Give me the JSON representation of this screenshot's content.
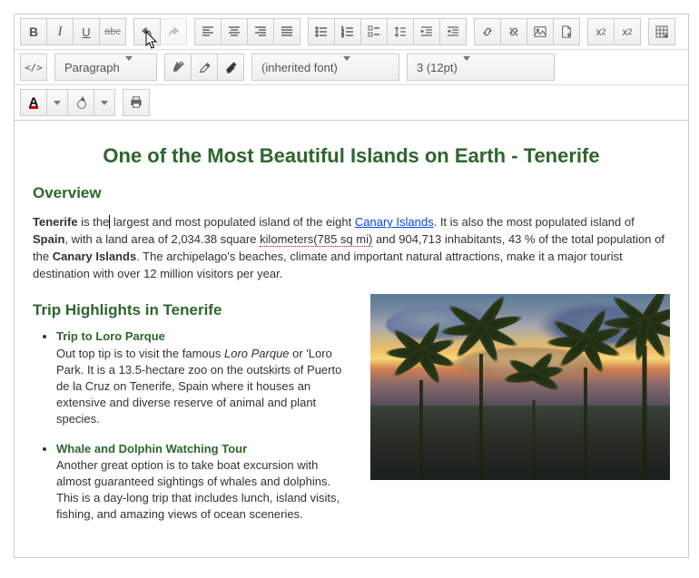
{
  "toolbar": {
    "bold": "B",
    "italic": "I",
    "underline": "U",
    "strike": "abc",
    "code": "</>",
    "paragraph_select": "Paragraph",
    "font_select": "(inherited font)",
    "size_select": "3 (12pt)",
    "color_a": "A",
    "sub": "x",
    "sub2": "2",
    "sup": "x",
    "sup2": "2"
  },
  "document": {
    "title": "One of the Most Beautiful Islands on Earth - Tenerife",
    "overview_heading": "Overview",
    "overview": {
      "w1": "Tenerife",
      "t1": " is the",
      "cursor": "|",
      "t1b": " largest and most populated island of the eight ",
      "link": "Canary Islands",
      "t2": ". It is also the most populated island of ",
      "w2": "Spain",
      "t3": ", with a land area of 2,034.38 square ",
      "sq1": "kilometers(785 sq mi)",
      "t4": " and 904,713 inhabitants, 43 % of the total population of the ",
      "w3": "Canary Islands",
      "t5": ". The archipelago's beaches, climate and important natural attractions, make it a major tourist destination with over 12 million visitors per year."
    },
    "highlights_heading": "Trip Highlights in Tenerife",
    "items": [
      {
        "title": "Trip to Loro Parque",
        "t1": "Out top tip is to visit the famous ",
        "em": "Loro Parque",
        "t2": " or 'Loro Park. It is a 13.5-hectare zoo on the outskirts of Puerto de la Cruz on Tenerife, Spain where it houses an extensive and diverse reserve of animal and plant species."
      },
      {
        "title": "Whale and Dolphin Watching Tour",
        "t1": "Another great option is to take boat excursion with almost guaranteed sightings of whales and dolphins. This is a day-long trip that includes lunch, island visits, fishing, and amazing views of ocean sceneries.",
        "em": "",
        "t2": ""
      }
    ]
  }
}
